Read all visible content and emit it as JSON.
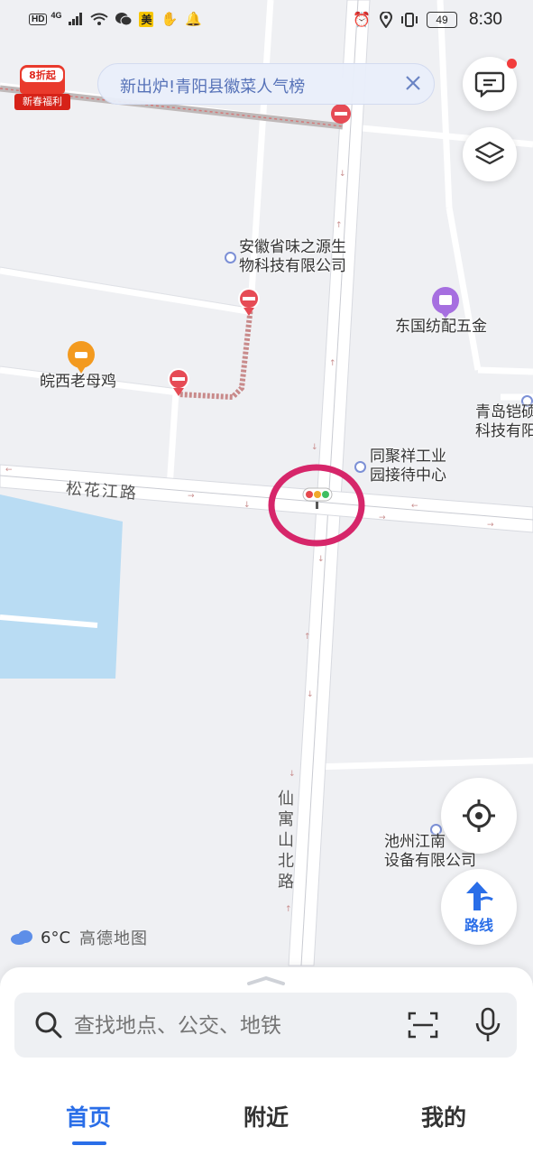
{
  "status_bar": {
    "network_hd": "HD",
    "network_gen": "4G",
    "app_badge": "美",
    "battery": "49",
    "time": "8:30"
  },
  "promo": {
    "badge_top": "8折起",
    "badge_bottom": "新春福利"
  },
  "banner": {
    "text": "新出炉!青阳县徽菜人气榜",
    "close_icon": "close-icon"
  },
  "map": {
    "road_songhuajiang": "松花江路",
    "road_xianyu": [
      "仙",
      "寓",
      "山",
      "北",
      "路"
    ],
    "pois": {
      "anhui_line1": "安徽省味之源生",
      "anhui_line2": "物科技有限公司",
      "dongguo": "东国纺配五金",
      "wanxi": "皖西老母鸡",
      "qingdao_line1": "青岛铠硕",
      "qingdao_line2": "科技有阳",
      "tongjuxiang_line1": "同聚祥工业",
      "tongjuxiang_line2": "园接待中心",
      "chizhou_line1": "池州江南",
      "chizhou_line2": "设备有限公司"
    },
    "highlight_color": "#d6266a"
  },
  "weather": {
    "temp": "6°C",
    "brand": "高德地图"
  },
  "route_button": {
    "label": "路线"
  },
  "search": {
    "placeholder": "查找地点、公交、地铁"
  },
  "nav": {
    "home": "首页",
    "nearby": "附近",
    "mine": "我的",
    "active_color": "#2a6ee8"
  }
}
